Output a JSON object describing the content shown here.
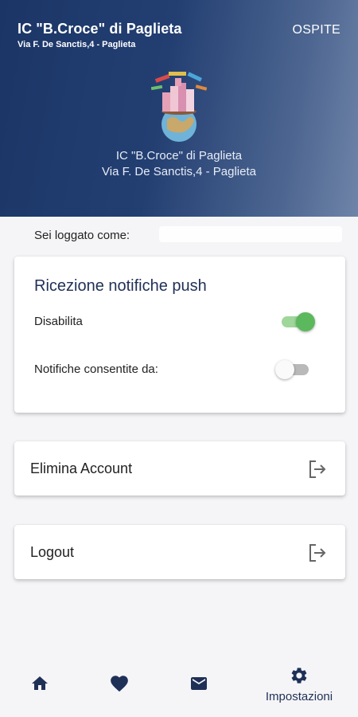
{
  "header": {
    "title": "IC \"B.Croce\" di Paglieta",
    "subtitle": "Via F. De Sanctis,4 - Paglieta",
    "guest_label": "OSPITE",
    "school_name": "IC \"B.Croce\" di Paglieta",
    "school_address": "Via F. De Sanctis,4 - Paglieta"
  },
  "session": {
    "logged_as_label": "Sei loggato come:"
  },
  "notifications": {
    "title": "Ricezione notifiche push",
    "disable_label": "Disabilita",
    "disable_toggle_on": true,
    "allowed_from_label": "Notifiche consentite da:",
    "allowed_from_toggle_on": false
  },
  "actions": {
    "delete_account_label": "Elimina Account",
    "logout_label": "Logout",
    "icon": "logout-arrow-icon"
  },
  "bottom_nav": {
    "items": [
      {
        "icon": "home-icon",
        "label": ""
      },
      {
        "icon": "heart-icon",
        "label": ""
      },
      {
        "icon": "mail-icon",
        "label": ""
      },
      {
        "icon": "gear-icon",
        "label": "Impostazioni",
        "active": true
      }
    ]
  },
  "colors": {
    "header_start": "#1b3566",
    "header_end": "#6f84a8",
    "accent": "#1f3057",
    "toggle_on": "#5cb85c"
  }
}
